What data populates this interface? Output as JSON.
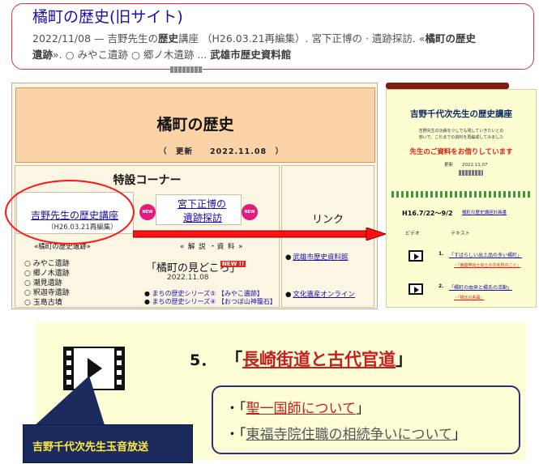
{
  "search_result": {
    "title": "橘町の歴史(旧サイト)",
    "date": "2022/11/08",
    "snippet_part1": " — 吉野先生の",
    "snippet_bold1": "歴史",
    "snippet_part2": "講座 （H26.03.21再編集）. 宮下正博の · 遺跡探訪. «",
    "snippet_bold2": "橘町の歴史",
    "snippet_bold3": "遺跡",
    "snippet_part3": "». ○ みやこ遺跡 ○ 郷ノ木遺跡 ... ",
    "snippet_bold4": "武雄市歴史資料館"
  },
  "old_site": {
    "title": "橘町の歴史",
    "update": "（　更新　　2022.11.08　）",
    "special_title": "特設コーナー",
    "yoshino_link": "吉野先生の歴史講座",
    "yoshino_sub": "（H26.03.21再編集）",
    "new_badge": "NEW",
    "miyashita_link1": "宮下正博の",
    "miyashita_link2": "遺跡探訪",
    "link_head": "リンク",
    "ruins_head": "«橘町の歴史遺跡»",
    "ruins": [
      "みやこ遺跡",
      "郷ノ木遺跡",
      "潮見遺跡",
      "釈迦寺遺跡",
      "玉島古墳"
    ],
    "ref_head": "«  解  説  ・資 料  »",
    "machi_title": "「橘町の見どころ」",
    "machi_new": "NEW !!",
    "machi_date": "2022.11.08",
    "series": [
      "まちの歴史シリーズ⑤ 【みやこ遺跡】",
      "まちの歴史シリーズ④ 【おつぼ山神籠石】"
    ],
    "links": [
      "武雄市歴史資料館",
      "文化遺産オンライン"
    ]
  },
  "lecture": {
    "title": "吉野千代次先生の歴史講座",
    "desc1": "吉野先生の功績を少しでも残していきたいとの",
    "desc2": "想いで、これまでの資料を再編成してみました",
    "ask": "先生のご資料をお借りしています",
    "update": "更新　　2022.11.07",
    "period": "H16.7/22～9/2",
    "plan": "橘町の歴史講座計画書",
    "col_video": "ビデオ",
    "col_text": "テキスト",
    "items": [
      {
        "num": "1.",
        "title": "「すばらしい出土品の多い橘町」",
        "sub": "・「番築帯出土出土の文化財のこと」"
      },
      {
        "num": "2.",
        "title": "「橘町の由来と橘氏の活動」",
        "sub": "・「橘氏の系図」"
      }
    ]
  },
  "enlarged": {
    "item_num": "5．",
    "item_open": "「",
    "item_title": "長崎街道と古代官道",
    "item_close": "」",
    "sub1_prefix": "・「",
    "sub1_title": "聖一国師について",
    "sub1_suffix": "」",
    "sub2_prefix": "・「",
    "sub2_title": "東福寺院住職の相続争いについて",
    "sub2_suffix": "」"
  },
  "callout": {
    "text": "吉野千代次先生玉音放送"
  },
  "colors": {
    "accent_red": "#ff1111",
    "link_blue": "#1a0dab",
    "header_peach": "#fcd3a7",
    "callout_navy": "#1b2b5e",
    "callout_text": "#ffeb3b"
  }
}
